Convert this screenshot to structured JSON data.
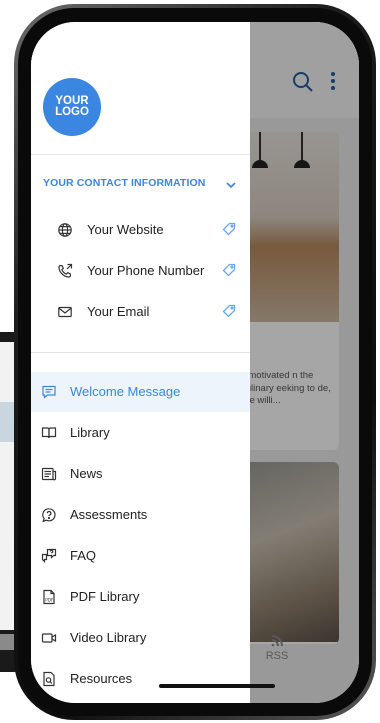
{
  "colors": {
    "accent": "#3b86e0",
    "app_accent": "#1f5fa8",
    "drawer_bg": "#ffffff",
    "active_row_bg": "#eef4fb"
  },
  "logo": {
    "line1": "YOUR",
    "line2": "LOGO"
  },
  "contact": {
    "title": "YOUR CONTACT INFORMATION",
    "expand_icon": "chevron-down-icon",
    "items": [
      {
        "label": "Your Website",
        "icon": "globe-icon",
        "action_icon": "tag-icon"
      },
      {
        "label": "Your Phone Number",
        "icon": "phone-outgoing-icon",
        "action_icon": "tag-icon"
      },
      {
        "label": "Your Email",
        "icon": "mail-icon",
        "action_icon": "tag-icon"
      }
    ]
  },
  "menu": {
    "active_index": 0,
    "items": [
      {
        "label": "Welcome Message",
        "icon": "message-icon"
      },
      {
        "label": "Library",
        "icon": "book-icon"
      },
      {
        "label": "News",
        "icon": "newspaper-icon"
      },
      {
        "label": "Assessments",
        "icon": "question-bubble-icon"
      },
      {
        "label": "FAQ",
        "icon": "faq-icon"
      },
      {
        "label": "PDF Library",
        "icon": "pdf-icon"
      },
      {
        "label": "Video Library",
        "icon": "video-icon"
      },
      {
        "label": "Resources",
        "icon": "resources-icon"
      }
    ]
  },
  "background_app": {
    "card1_text": "y motivated n the culinary eeking to de, are willi...",
    "rss_label": "RSS",
    "search_icon": "search-icon",
    "more_icon": "more-vertical-icon"
  }
}
